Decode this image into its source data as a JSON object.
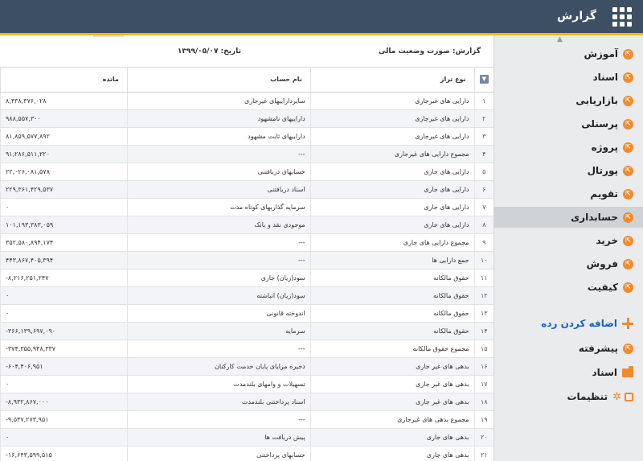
{
  "app": {
    "title": "گزارش"
  },
  "report": {
    "title": "گزارش: صورت وضعیت مالی",
    "date": "تاریخ: ۱۳۹۹/۰۵/۰۷",
    "columns": {
      "type": "نوع تراز",
      "account": "نام حساب",
      "balance": "مانده"
    },
    "rows": [
      {
        "n": "۱",
        "type": "دارایی های غیرجاری",
        "account": "سایرداراییهای غیرجاری",
        "balance": "۸,۴۳۸,۳۷۶,۰۲۸"
      },
      {
        "n": "۲",
        "type": "دارایی های غیرجاری",
        "account": "داراییهای نامشهود",
        "balance": "۹۸۸,۵۵۷,۳۰۰"
      },
      {
        "n": "۳",
        "type": "دارایی های غیرجاری",
        "account": "داراییهای ثابت مشهود",
        "balance": "۸۱,۸۵۹,۵۷۷,۸۹۲"
      },
      {
        "n": "۴",
        "type": "مجموع دارایی های غیرجاری",
        "account": "---",
        "balance": "۹۱,۲۸۶,۵۱۱,۲۲۰"
      },
      {
        "n": "۵",
        "type": "دارایی های جاری",
        "account": "حسابهای دریافتنی",
        "balance": "۲۲,۰۲۶,۰۸۱,۵۷۸"
      },
      {
        "n": "۶",
        "type": "دارایی های جاری",
        "account": "اسناد دریافتنی",
        "balance": "۲۲۹,۳۶۱,۴۲۹,۵۳۷"
      },
      {
        "n": "۷",
        "type": "دارایی های جاری",
        "account": "سرمایه گذاریهای کوتاه مدت",
        "balance": "۰"
      },
      {
        "n": "۸",
        "type": "دارایی های جاری",
        "account": "موجودی نقد و بانک",
        "balance": "۱۰۱,۱۹۳,۳۸۳,۰۵۹"
      },
      {
        "n": "۹",
        "type": "مجموع دارایی های جاری",
        "account": "---",
        "balance": "۳۵۲,۵۸۰,۸۹۴,۱۷۴"
      },
      {
        "n": "۱۰",
        "type": "جمع دارایی ها",
        "account": "---",
        "balance": "۴۴۳,۸۶۷,۴۰۵,۳۹۴"
      },
      {
        "n": "۱۱",
        "type": "حقوق مالکانه",
        "account": "سود(زیان) جاری",
        "balance": "-۸,۲۱۶,۲۵۱,۲۴۷"
      },
      {
        "n": "۱۲",
        "type": "حقوق مالکانه",
        "account": "سود(زیان) انباشته",
        "balance": "۰"
      },
      {
        "n": "۱۳",
        "type": "حقوق مالکانه",
        "account": "اندوخته قانونی",
        "balance": "۰"
      },
      {
        "n": "۱۴",
        "type": "حقوق مالکانه",
        "account": "سرمایه",
        "balance": "-۳۶۶,۱۳۹,۶۹۷,۰۹۰"
      },
      {
        "n": "۱۵",
        "type": "مجموع حقوق مالکانه",
        "account": "---",
        "balance": "-۳۷۴,۳۵۵,۹۴۸,۳۳۷"
      },
      {
        "n": "۱۶",
        "type": "بدهی های غیر جاری",
        "account": "ذخیره مزایای پایان خدمت کارکنان",
        "balance": "-۶۰۴,۴۰۶,۹۵۱"
      },
      {
        "n": "۱۷",
        "type": "بدهی های غیر جاری",
        "account": "تسهیلات و وامهای بلندمدت",
        "balance": "۰"
      },
      {
        "n": "۱۸",
        "type": "بدهی های غیر جاری",
        "account": "اسناد پرداختنی بلندمدت",
        "balance": "-۸,۹۳۲,۸۶۷,۰۰۰"
      },
      {
        "n": "۱۹",
        "type": "مجموع بدهی های غیرجاری",
        "account": "---",
        "balance": "-۹,۵۳۷,۲۷۳,۹۵۱"
      },
      {
        "n": "۲۰",
        "type": "بدهی های جاری",
        "account": "پیش دریافت ها",
        "balance": "۰"
      },
      {
        "n": "۲۱",
        "type": "بدهی های جاری",
        "account": "حسابهای پرداختنی",
        "balance": "-۱۶,۶۴۳,۵۹۹,۵۱۵"
      }
    ]
  },
  "sidebar": {
    "items": [
      {
        "label": "آموزش",
        "icon": "link-icon",
        "active": false
      },
      {
        "label": "اسناد",
        "icon": "link-icon",
        "active": false
      },
      {
        "label": "بازاریابی",
        "icon": "link-icon",
        "active": false
      },
      {
        "label": "پرسنلی",
        "icon": "link-icon",
        "active": false
      },
      {
        "label": "پروژه",
        "icon": "link-icon",
        "active": false
      },
      {
        "label": "پورتال",
        "icon": "link-icon",
        "active": false
      },
      {
        "label": "تقویم",
        "icon": "link-icon",
        "active": false
      },
      {
        "label": "حسابداری",
        "icon": "link-icon",
        "active": true
      },
      {
        "label": "خرید",
        "icon": "link-icon",
        "active": false
      },
      {
        "label": "فروش",
        "icon": "link-icon",
        "active": false
      },
      {
        "label": "کیفیت",
        "icon": "link-icon",
        "active": false
      }
    ],
    "add_label": "اضافه کردن رده",
    "extra": [
      {
        "label": "پیشرفته",
        "icon": "link-icon"
      },
      {
        "label": "اسناد",
        "icon": "folder-icon"
      },
      {
        "label": "تنظیمات",
        "icon": "gear-icon"
      }
    ]
  },
  "colors": {
    "topbar": "#3d4f63",
    "accent": "#f3b91a",
    "icon": "#f28a2e",
    "link": "#1a5fc4"
  }
}
